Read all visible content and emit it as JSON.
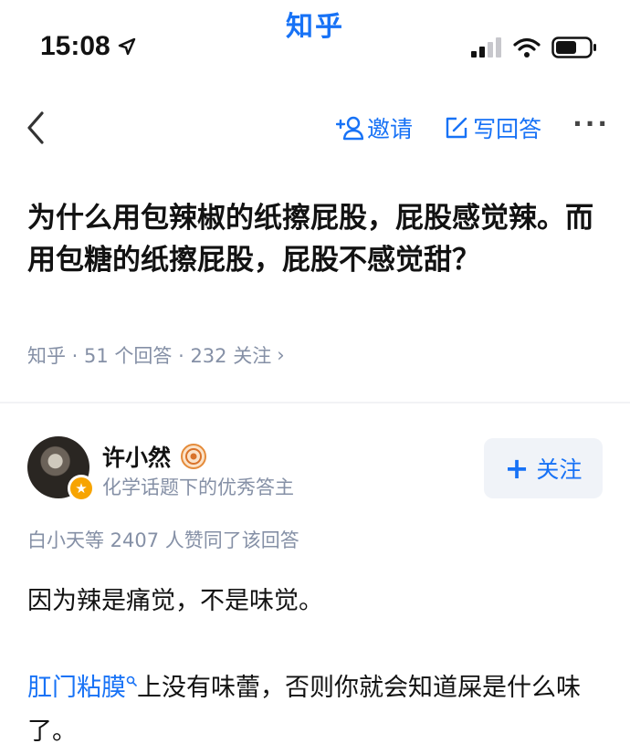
{
  "app_name": "知乎",
  "status": {
    "time": "15:08"
  },
  "nav": {
    "invite": "邀请",
    "write_answer": "写回答",
    "more": "···"
  },
  "question": {
    "title": "为什么用包辣椒的纸擦屁股，屁股感觉辣。而用包糖的纸擦屁股，屁股不感觉甜？",
    "meta": "知乎 · 51 个回答 · 232 关注",
    "meta_chevron": "›"
  },
  "author": {
    "name": "许小然",
    "desc": "化学话题下的优秀答主",
    "follow": "关注",
    "follow_plus": "+"
  },
  "answer": {
    "vote_summary": "白小天等 2407 人赞同了该回答",
    "p1": "因为辣是痛觉，不是味觉。",
    "link_text": "肛门粘膜",
    "p2_rest": "上没有味蕾，否则你就会知道屎是什么味了。"
  },
  "colors": {
    "accent": "#1772f6",
    "muted": "#8590a6",
    "badge": "#f7a400"
  },
  "icons": [
    "location-arrow-icon",
    "signal-icon",
    "wifi-icon",
    "battery-icon",
    "back-chevron-icon",
    "invite-person-icon",
    "edit-icon",
    "more-icon",
    "emblem-icon",
    "star-badge-icon",
    "search-icon"
  ]
}
